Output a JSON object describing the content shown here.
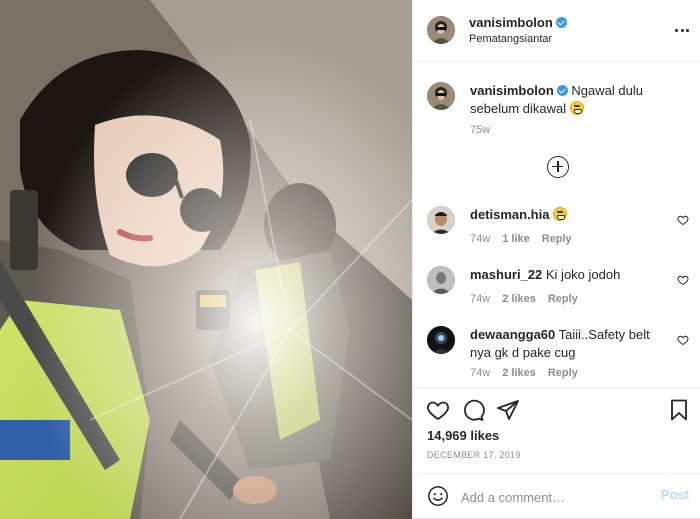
{
  "header": {
    "username": "vanisimbolon",
    "location": "Pematangsiantar",
    "verified": true,
    "more_icon": "more-options-icon"
  },
  "caption": {
    "username": "vanisimbolon",
    "text": "Ngawal dulu sebelum dikawal",
    "emoji": "grinning-sweat-emoji",
    "time": "75w"
  },
  "load_more_icon": "plus-circle-icon",
  "comments": [
    {
      "username": "detisman.hia",
      "text": "",
      "emoji": "grinning-sweat-emoji",
      "time": "74w",
      "likes": "1 like",
      "reply": "Reply"
    },
    {
      "username": "mashuri_22",
      "text": "Ki joko jodoh",
      "time": "74w",
      "likes": "2 likes",
      "reply": "Reply"
    },
    {
      "username": "dewaangga60",
      "text": "Taiii..Safety belt nya gk d pake cug",
      "time": "74w",
      "likes": "2 likes",
      "reply": "Reply"
    }
  ],
  "actions": {
    "like_icon": "heart-icon",
    "comment_icon": "comment-icon",
    "share_icon": "share-icon",
    "save_icon": "bookmark-icon",
    "likes": "14,969 likes",
    "date": "DECEMBER 17, 2019"
  },
  "add_comment": {
    "placeholder": "Add a comment…",
    "post_label": "Post",
    "emoji_icon": "smiley-icon"
  },
  "colors": {
    "verified": "#3897f0",
    "post_disabled": "#b2dffc",
    "meta": "#8e8e8e",
    "text": "#262626"
  }
}
